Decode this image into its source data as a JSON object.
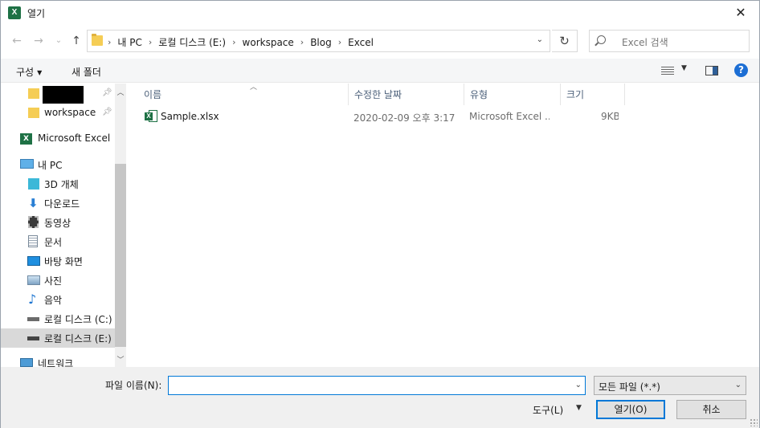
{
  "window": {
    "title": "열기",
    "app_icon_letter": "X",
    "close_glyph": "✕"
  },
  "nav": {
    "back": "←",
    "forward": "→",
    "recent": "⌄",
    "up": "↑",
    "breadcrumbs": [
      "내 PC",
      "로컬 디스크 (E:)",
      "workspace",
      "Blog",
      "Excel"
    ],
    "refresh": "↻",
    "search_placeholder": "Excel 검색"
  },
  "toolbar": {
    "organize": "구성",
    "new_folder": "새 폴더",
    "help": "?"
  },
  "sidebar": {
    "items": [
      {
        "label": "",
        "icon": "folder-icon",
        "pinned": true,
        "redacted": true
      },
      {
        "label": "workspace",
        "icon": "folder-icon",
        "pinned": true
      },
      {
        "label": "Microsoft Excel",
        "icon": "excel-icon"
      },
      {
        "label": "내 PC",
        "icon": "computer-icon"
      },
      {
        "label": "3D 개체",
        "icon": "3d-objects-icon"
      },
      {
        "label": "다운로드",
        "icon": "download-icon"
      },
      {
        "label": "동영상",
        "icon": "video-icon"
      },
      {
        "label": "문서",
        "icon": "document-icon"
      },
      {
        "label": "바탕 화면",
        "icon": "desktop-icon"
      },
      {
        "label": "사진",
        "icon": "pictures-icon"
      },
      {
        "label": "음악",
        "icon": "music-icon"
      },
      {
        "label": "로컬 디스크 (C:)",
        "icon": "drive-icon"
      },
      {
        "label": "로컬 디스크 (E:)",
        "icon": "drive-icon",
        "selected": true
      },
      {
        "label": "네트워크",
        "icon": "network-icon"
      }
    ]
  },
  "columns": {
    "name": "이름",
    "modified": "수정한 날짜",
    "type": "유형",
    "size": "크기"
  },
  "files": [
    {
      "name": "Sample.xlsx",
      "modified": "2020-02-09 오후 3:17",
      "type": "Microsoft Excel ...",
      "size": "9KB"
    }
  ],
  "bottom": {
    "filename_label": "파일 이름(N):",
    "filename_value": "",
    "filetype": "모든 파일 (*.*)",
    "tools": "도구(L)",
    "open": "열기(O)",
    "cancel": "취소"
  }
}
